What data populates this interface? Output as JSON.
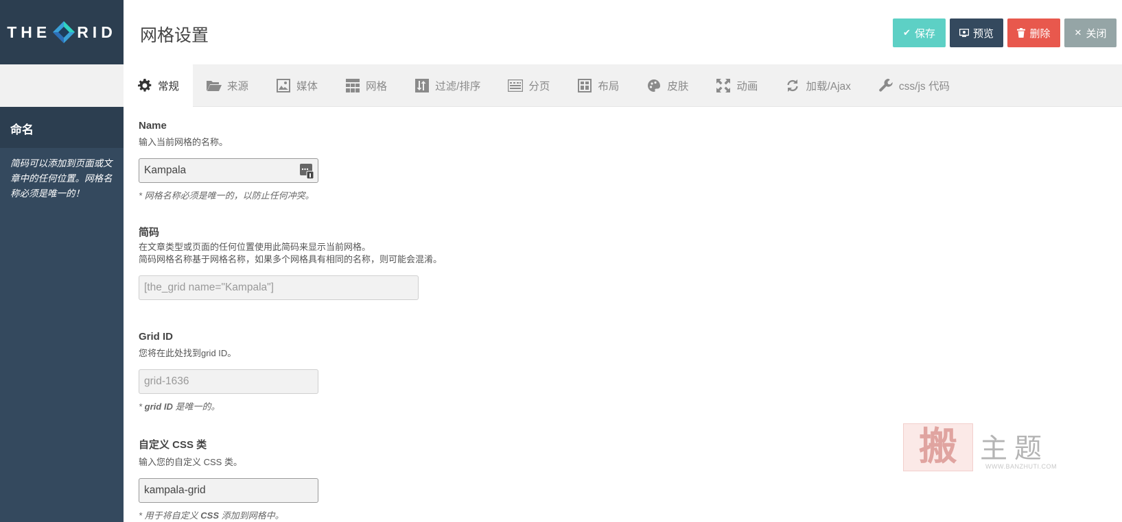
{
  "logo": {
    "left": "THE",
    "right": "RID"
  },
  "sidebar": {
    "title": "命名",
    "description": "简码可以添加到页面或文章中的任何位置。网格名称必须是唯一的！"
  },
  "header": {
    "title": "网格设置",
    "buttons": {
      "save": "保存",
      "preview": "预览",
      "delete": "删除",
      "close": "关闭"
    }
  },
  "tabs": [
    {
      "label": "常规",
      "icon": "gear-icon"
    },
    {
      "label": "来源",
      "icon": "folder-icon"
    },
    {
      "label": "媒体",
      "icon": "image-icon"
    },
    {
      "label": "网格",
      "icon": "grid-icon"
    },
    {
      "label": "过滤/排序",
      "icon": "sort-icon"
    },
    {
      "label": "分页",
      "icon": "pagination-icon"
    },
    {
      "label": "布局",
      "icon": "layout-icon"
    },
    {
      "label": "皮肤",
      "icon": "palette-icon"
    },
    {
      "label": "动画",
      "icon": "expand-arrows-icon"
    },
    {
      "label": "加载/Ajax",
      "icon": "refresh-icon"
    },
    {
      "label": "css/js 代码",
      "icon": "wrench-icon"
    }
  ],
  "fields": {
    "name": {
      "label": "Name",
      "description": "输入当前网格的名称。",
      "value": "Kampala",
      "note": "* 网格名称必须是唯一的，以防止任何冲突。"
    },
    "shortcode": {
      "label": "简码",
      "description_1": "在文章类型或页面的任何位置使用此简码来显示当前网格。",
      "description_2": "简码网格名称基于网格名称，如果多个网格具有相同的名称，则可能会混淆。",
      "value": "[the_grid name=\"Kampala\"]"
    },
    "grid_id": {
      "label": "Grid ID",
      "description": "您将在此处找到grid ID。",
      "value": "grid-1636",
      "note_prefix": "* ",
      "note_bold": "grid ID",
      "note_suffix": " 是唯一的。"
    },
    "css_class": {
      "label": "自定义 CSS 类",
      "description": "输入您的自定义 CSS 类。",
      "value": "kampala-grid",
      "note_prefix": "* 用于将自定义 ",
      "note_bold": "CSS",
      "note_suffix": " 添加到网格中。"
    }
  },
  "watermark": {
    "seal": "搬",
    "text": "主题",
    "url": "WWW.BANZHUTI.COM"
  },
  "colors": {
    "sidebar": "#34495e",
    "sidebar_dark": "#2c3e50",
    "save": "#5dd0c5",
    "preview": "#34495e",
    "delete": "#e8584d",
    "close": "#95a5a6"
  }
}
